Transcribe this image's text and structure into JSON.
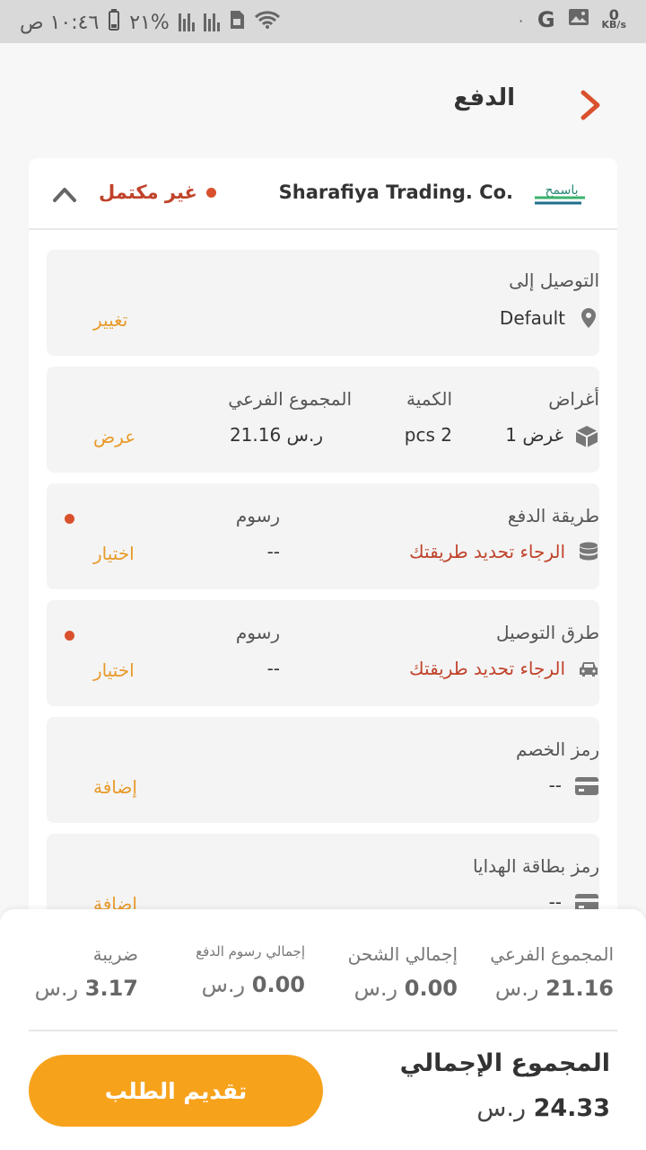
{
  "status_bar": {
    "time": "١٠:٤٦ ص",
    "battery": "٢١%",
    "net_speed": "0",
    "net_unit": "KB/s",
    "dot": "٠",
    "g_icon": "G"
  },
  "header": {
    "title": "الدفع",
    "back_icon": "chevron-right-icon"
  },
  "shop": {
    "name": "Sharafiya Trading. Co.",
    "status": "غير مكتمل",
    "logo_text": "باسمح"
  },
  "delivery": {
    "label": "التوصيل إلى",
    "value": "Default",
    "action": "تغيير"
  },
  "items": {
    "items_label": "أغراض",
    "items_value": "1 غرض",
    "qty_label": "الكمية",
    "qty_value": "pcs 2",
    "subtotal_label": "المجموع الفرعي",
    "subtotal_value": "ر.س 21.16",
    "action": "عرض"
  },
  "payment": {
    "label": "طريقة الدفع",
    "value": "الرجاء تحديد طريقتك",
    "fee_label": "رسوم",
    "fee_value": "--",
    "action": "اختيار"
  },
  "shipping": {
    "label": "طرق التوصيل",
    "value": "الرجاء تحديد طريقتك",
    "fee_label": "رسوم",
    "fee_value": "--",
    "action": "اختيار"
  },
  "discount": {
    "label": "رمز الخصم",
    "value": "--",
    "action": "إضافة"
  },
  "gift": {
    "label": "رمز بطاقة الهدايا",
    "value": "--",
    "action": "إضافة"
  },
  "summary": {
    "currency": "ر.س",
    "subtotal_label": "المجموع الفرعي",
    "subtotal_value": "21.16",
    "shipping_label": "إجمالي الشحن",
    "shipping_value": "0.00",
    "payfee_label": "إجمالي رسوم الدفع",
    "payfee_value": "0.00",
    "tax_label": "ضريبة",
    "tax_value": "3.17",
    "grand_label": "المجموع الإجمالي",
    "grand_value": "24.33",
    "submit_label": "تقديم الطلب"
  },
  "colors": {
    "accent": "#f7a21b",
    "warning": "#c0432b",
    "action": "#e89a2a"
  }
}
